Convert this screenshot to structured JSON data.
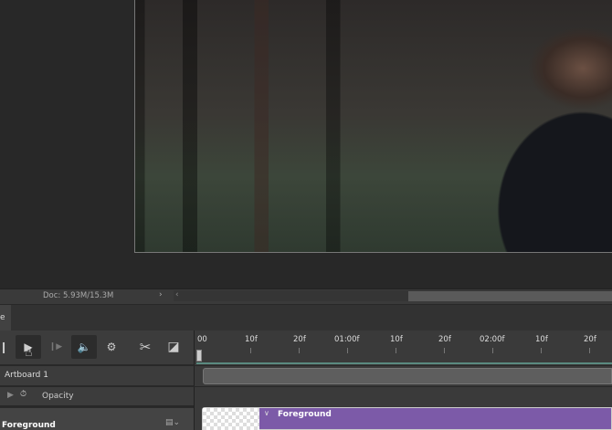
{
  "status_bar": {
    "doc_info": "Doc: 5.93M/15.3M",
    "nav_right": "›",
    "nav_left": "‹"
  },
  "panel": {
    "tab_label": "e"
  },
  "controls": {
    "prev": "❙",
    "play": "▶",
    "next": "❙▶",
    "audio": "🔈",
    "settings": "⚙",
    "split": "✂",
    "transition": "◪"
  },
  "ruler": {
    "ticks": [
      "00",
      "10f",
      "20f",
      "01:00f",
      "10f",
      "20f",
      "02:00f",
      "10f",
      "20f"
    ]
  },
  "layers": {
    "artboard": "Artboard 1",
    "opacity": "Opacity",
    "foreground": "Foreground"
  },
  "clip": {
    "label": "Foreground",
    "color": "#7c5aa8"
  }
}
